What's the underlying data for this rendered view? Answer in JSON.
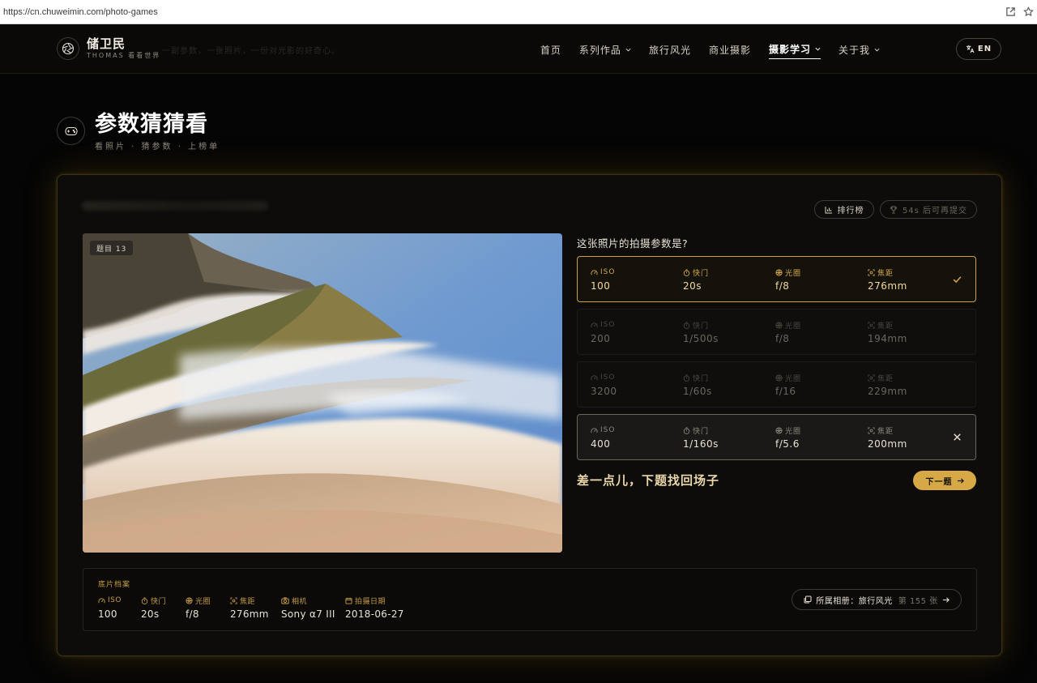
{
  "browser": {
    "url": "https://cn.chuweimin.com/photo-games"
  },
  "nav": {
    "logo_cn": "储卫民",
    "logo_sub": "THOMAS 看看世界",
    "ghost_text": "一副参数，一张照片，一份对光影的好奇心。",
    "links": [
      {
        "label": "首页",
        "has_menu": false,
        "active": false
      },
      {
        "label": "系列作品",
        "has_menu": true,
        "active": false
      },
      {
        "label": "旅行风光",
        "has_menu": false,
        "active": false
      },
      {
        "label": "商业摄影",
        "has_menu": false,
        "active": false
      },
      {
        "label": "摄影学习",
        "has_menu": true,
        "active": true
      },
      {
        "label": "关于我",
        "has_menu": true,
        "active": false
      }
    ],
    "lang_label": "EN"
  },
  "page": {
    "title": "参数猜猜看",
    "subtitle": "看照片 · 猜参数 · 上榜单"
  },
  "game": {
    "leaderboard_label": "排行榜",
    "cooldown_label": "54s 后可再提交",
    "question_badge": "题目 13",
    "question": "这张照片的拍摄参数是?",
    "labels": {
      "iso": "ISO",
      "shutter": "快门",
      "aperture": "光圈",
      "focal": "焦距"
    },
    "options": [
      {
        "iso": "100",
        "shutter": "20s",
        "aperture": "f/8",
        "focal": "276mm",
        "state": "correct"
      },
      {
        "iso": "200",
        "shutter": "1/500s",
        "aperture": "f/8",
        "focal": "194mm",
        "state": "dim"
      },
      {
        "iso": "3200",
        "shutter": "1/60s",
        "aperture": "f/16",
        "focal": "229mm",
        "state": "dim"
      },
      {
        "iso": "400",
        "shutter": "1/160s",
        "aperture": "f/5.6",
        "focal": "200mm",
        "state": "wrong"
      }
    ],
    "result_text": "差一点儿，下题找回场子",
    "next_label": "下一题"
  },
  "archive": {
    "title": "底片档案",
    "fields": [
      {
        "label": "ISO",
        "value": "100",
        "icon": "gauge-icon"
      },
      {
        "label": "快门",
        "value": "20s",
        "icon": "timer-icon"
      },
      {
        "label": "光圈",
        "value": "f/8",
        "icon": "aperture-icon"
      },
      {
        "label": "焦距",
        "value": "276mm",
        "icon": "focus-icon"
      },
      {
        "label": "相机",
        "value": "Sony α7 III",
        "icon": "camera-icon"
      },
      {
        "label": "拍摄日期",
        "value": "2018-06-27",
        "icon": "calendar-icon"
      }
    ],
    "album_label": "所属相册：旅行风光",
    "album_index": "第 155 张"
  },
  "colors": {
    "accent": "#d6a946",
    "bg": "#050505",
    "card": "#0d0c0a"
  }
}
